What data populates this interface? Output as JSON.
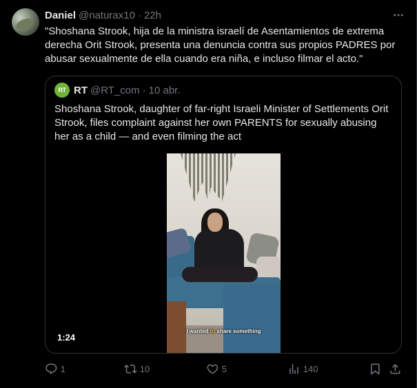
{
  "post": {
    "author_name": "Daniel",
    "author_handle": "@naturax10",
    "separator": "·",
    "time": "22h",
    "text": "\"Shoshana Strook, hija de la ministra israelí de Asentamientos de extrema derecha Orit Strook, presenta una denuncia contra sus propios PADRES por abusar sexualmente de ella cuando era niña, e incluso filmar el acto.\""
  },
  "quote": {
    "logo_text": "RT",
    "author_name": "RT",
    "author_handle": "@RT_com",
    "separator": "·",
    "date": "10 abr.",
    "text": "Shoshana Strook, daughter of far-right Israeli Minister of Settlements Orit Strook, files complaint against her own PARENTS for sexually abusing her as a child — and even filming the act",
    "video": {
      "subtitle_before": "I wanted ",
      "subtitle_highlight": "to",
      "subtitle_after": " share something",
      "duration": "1:24"
    }
  },
  "actions": {
    "replies": "1",
    "reposts": "10",
    "likes": "5",
    "views": "140"
  },
  "icons": {
    "more": "more-horizontal-icon",
    "reply": "reply-icon",
    "repost": "repost-icon",
    "like": "heart-icon",
    "views": "views-icon",
    "bookmark": "bookmark-icon",
    "share": "share-icon"
  },
  "colors": {
    "background": "#000000",
    "text_primary": "#e7e9ea",
    "text_secondary": "#71767b",
    "border": "#2f3336",
    "rt_logo": "#6fb33a"
  }
}
